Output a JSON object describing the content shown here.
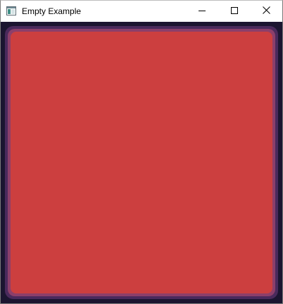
{
  "window": {
    "title": "Empty Example",
    "icon": "app-window-icon",
    "controls": {
      "minimize_icon": "minimize-icon",
      "maximize_icon": "maximize-icon",
      "close_icon": "close-icon"
    }
  },
  "canvas": {
    "background_color": "#1b1530",
    "frame_outer_color": "#4a2a5c",
    "frame_inner_color": "#8c3f6a",
    "panel_color": "#cc3f3f"
  }
}
